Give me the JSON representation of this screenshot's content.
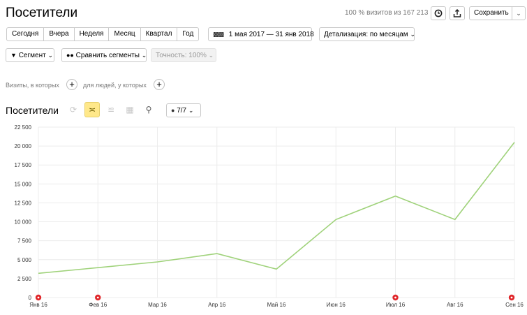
{
  "header": {
    "title": "Посетители",
    "visits_note": "100 % визитов из 167 213",
    "save_label": "Сохранить"
  },
  "periods": [
    "Сегодня",
    "Вчера",
    "Неделя",
    "Месяц",
    "Квартал",
    "Год"
  ],
  "date_range": "1 мая 2017 — 31 янв 2018",
  "detail": "Детализация: по месяцам",
  "segment": {
    "segment_label": "Сегмент",
    "compare_label": "Сравнить сегменты",
    "accuracy_label": "Точность: 100%"
  },
  "filters": {
    "visits_label": "Визиты, в которых",
    "people_label": "для людей, у которых"
  },
  "chart_header": {
    "title": "Посетители",
    "annotations_label": "7/7"
  },
  "colors": {
    "line": "#9fd27a",
    "active_tool": "#ffe88a",
    "marker": "#e0262a"
  },
  "chart_data": {
    "type": "line",
    "title": "Посетители",
    "xlabel": "",
    "ylabel": "",
    "categories": [
      "Янв 16",
      "Фев 16",
      "Мар 16",
      "Апр 16",
      "Май 16",
      "Июн 16",
      "Июл 16",
      "Авг 16",
      "Сен 16"
    ],
    "series": [
      {
        "values": [
          3200,
          3950,
          4700,
          5800,
          3750,
          10300,
          13400,
          10300,
          20500
        ]
      }
    ],
    "ylim": [
      0,
      22500
    ],
    "yticks": [
      0,
      2500,
      5000,
      7500,
      10000,
      12500,
      15000,
      17500,
      20000,
      22500
    ],
    "ytick_labels": [
      "0",
      "2 500",
      "5 000",
      "7 500",
      "10 000",
      "12 500",
      "15 000",
      "17 500",
      "20 000",
      "22 500"
    ],
    "grid": true,
    "annotation_markers": [
      0,
      1,
      6,
      8
    ]
  }
}
